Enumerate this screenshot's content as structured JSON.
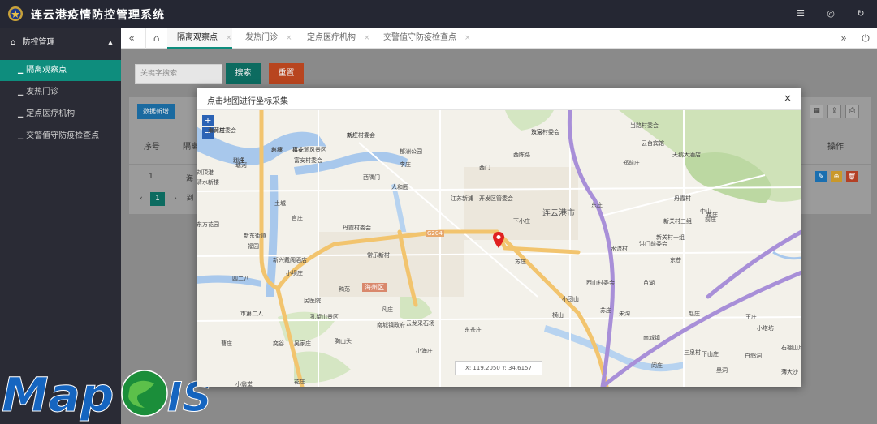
{
  "app": {
    "title": "连云港疫情防控管理系统",
    "header_icons": [
      "menu-icon",
      "theme-icon",
      "refresh-icon"
    ]
  },
  "sidebar": {
    "group_label": "防控管理",
    "items": [
      {
        "label": "隔离观察点",
        "active": true
      },
      {
        "label": "发热门诊",
        "active": false
      },
      {
        "label": "定点医疗机构",
        "active": false
      },
      {
        "label": "交警值守防疫检查点",
        "active": false
      }
    ]
  },
  "tabs": {
    "items": [
      {
        "label": "隔离观察点",
        "active": true
      },
      {
        "label": "发热门诊",
        "active": false
      },
      {
        "label": "定点医疗机构",
        "active": false
      },
      {
        "label": "交警值守防疫检查点",
        "active": false
      }
    ],
    "close_glyph": "×"
  },
  "toolbar": {
    "search_placeholder": "关键字搜索",
    "search_label": "搜索",
    "reset_label": "重置",
    "add_label": "数据新增"
  },
  "table": {
    "columns": [
      "序号",
      "隔离",
      "操作"
    ],
    "rows": [
      {
        "index": "1",
        "name": "海"
      }
    ],
    "pager": {
      "current": "1",
      "goto_prefix": "到"
    }
  },
  "modal": {
    "title": "点击地图进行坐标采集",
    "close_glyph": "×",
    "zoom_in": "+",
    "zoom_out": "−",
    "coordinate_readout": "X: 119.2050  Y: 34.6157",
    "district_badge": "海州区",
    "road_badge": "G204"
  },
  "map_labels": {
    "big": [
      "连云港市"
    ],
    "small": [
      "小黄庄",
      "赵巷",
      "富安",
      "新圩",
      "沙圩",
      "东河",
      "当路村委会",
      "富安村委会",
      "郁洲公园",
      "西门",
      "西陈路",
      "天鹅大酒店",
      "刘顶港",
      "西隅门",
      "李庄",
      "人和园",
      "清水新楼",
      "塘河",
      "江苏新浦",
      "开发区管委会",
      "郑前庄",
      "云台宾馆",
      "新东街道",
      "下小庄",
      "东庄",
      "丹霞村",
      "土城",
      "中山",
      "东方花园",
      "官庄",
      "丹霞村委会",
      "新关村三组",
      "花庄",
      "洪门前委会",
      "常乐新村",
      "苏庄",
      "水流村",
      "新关村十组",
      "东苍",
      "前庄",
      "福园",
      "新兴戴阁酒店",
      "小坝庄",
      "鸭荡",
      "西山村委会",
      "苗湖",
      "四二八",
      "市第二人",
      "民医院",
      "凡庄",
      "小团山",
      "苏庄",
      "朱沟",
      "赵庄",
      "王庄",
      "孔望山景区",
      "南城镇政府",
      "云龙采石场",
      "横山",
      "东苍庄",
      "曹庄",
      "奕谷",
      "吴家庄",
      "胸山头",
      "小海庄",
      "南城镇",
      "三泉村",
      "下山庄",
      "白鸽洞",
      "黑洞",
      "石棚山风景区",
      "薄大沙",
      "花庄",
      "小翁堂",
      "小塔坊",
      "闵庄",
      "海河村委会",
      "东原",
      "桃花涧风景区",
      "刘庄村委会",
      "利庄",
      "汝家村委会"
    ]
  },
  "watermark": {
    "brand": "MapGIS",
    "registered": "®"
  }
}
